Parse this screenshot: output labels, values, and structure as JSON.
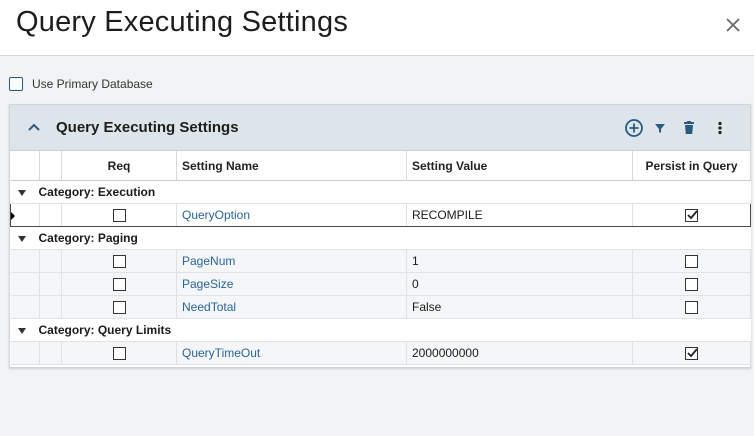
{
  "dialog": {
    "title": "Query Executing Settings",
    "close_icon": "close-x-icon"
  },
  "primary_db": {
    "label": "Use Primary Database",
    "checked": false
  },
  "panel": {
    "title": "Query Executing Settings",
    "icons": [
      "chevron-up-icon",
      "add-circle-icon",
      "filter-icon",
      "trash-icon",
      "more-vertical-icon"
    ],
    "accent_color": "#2a5a82"
  },
  "columns": {
    "req": "Req",
    "setting_name": "Setting Name",
    "setting_value": "Setting Value",
    "persist": "Persist in Query"
  },
  "groups": [
    {
      "label": "Category: Execution",
      "rows": [
        {
          "req": false,
          "name": "QueryOption",
          "value": "RECOMPILE",
          "persist": true,
          "selected": true
        }
      ]
    },
    {
      "label": "Category: Paging",
      "rows": [
        {
          "req": false,
          "name": "PageNum",
          "value": "1",
          "persist": false,
          "selected": false
        },
        {
          "req": false,
          "name": "PageSize",
          "value": "0",
          "persist": false,
          "selected": false
        },
        {
          "req": false,
          "name": "NeedTotal",
          "value": "False",
          "persist": false,
          "selected": false
        }
      ]
    },
    {
      "label": "Category: Query Limits",
      "rows": [
        {
          "req": false,
          "name": "QueryTimeOut",
          "value": "2000000000",
          "persist": true,
          "selected": false
        }
      ]
    }
  ]
}
